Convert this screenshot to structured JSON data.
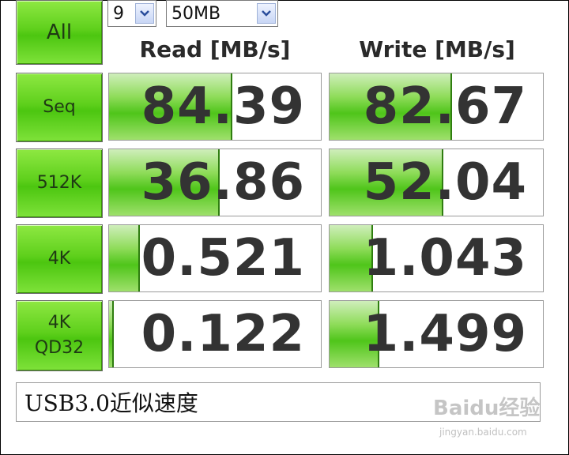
{
  "controls": {
    "all_label": "All",
    "test_count": "9",
    "test_size": "50MB"
  },
  "headers": {
    "read": "Read [MB/s]",
    "write": "Write [MB/s]"
  },
  "rows": [
    {
      "label": "Seq",
      "read": "84.39",
      "write": "82.67",
      "read_fill": 0.58,
      "write_fill": 0.57
    },
    {
      "label": "512K",
      "read": "36.86",
      "write": "52.04",
      "read_fill": 0.52,
      "write_fill": 0.53
    },
    {
      "label": "4K",
      "read": "0.521",
      "write": "1.043",
      "read_fill": 0.14,
      "write_fill": 0.2
    },
    {
      "label_line1": "4K",
      "label_line2": "QD32",
      "read": "0.122",
      "write": "1.499",
      "read_fill": 0.02,
      "write_fill": 0.23
    }
  ],
  "comment": "USB3.0近似速度",
  "watermark": {
    "brand": "Baidu经验",
    "url": "jingyan.baidu.com"
  },
  "colors": {
    "button_green": "#5fd01c",
    "bar_green": "#4fc51a",
    "text_dark": "#333333"
  },
  "icons": {
    "dropdown": "chevron-down-icon"
  }
}
